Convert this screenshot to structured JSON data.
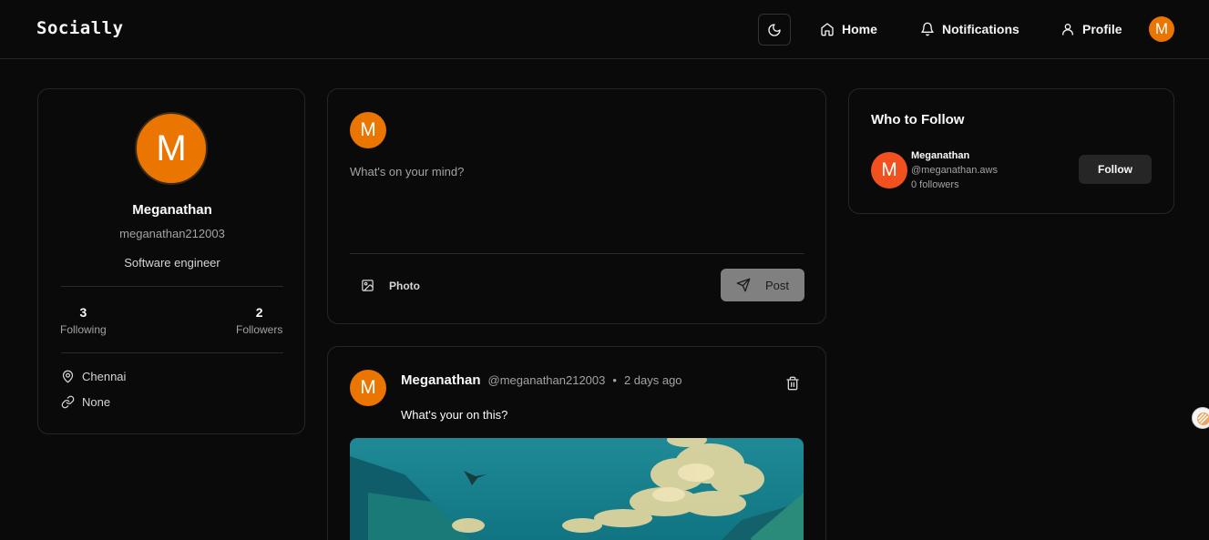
{
  "header": {
    "brand": "Socially",
    "nav": {
      "home": "Home",
      "notifications": "Notifications",
      "profile": "Profile"
    },
    "avatar_initial": "M"
  },
  "profile": {
    "avatar_initial": "M",
    "name": "Meganathan",
    "username": "meganathan212003",
    "bio": "Software engineer",
    "following_count": "3",
    "following_label": "Following",
    "followers_count": "2",
    "followers_label": "Followers",
    "location": "Chennai",
    "website": "None"
  },
  "composer": {
    "avatar_initial": "M",
    "placeholder": "What's on your mind?",
    "photo_label": "Photo",
    "post_label": "Post"
  },
  "post": {
    "avatar_initial": "M",
    "author": "Meganathan",
    "handle": "@meganathan212003",
    "separator": "•",
    "time": "2 days ago",
    "text": "What's your on this?"
  },
  "who_to_follow": {
    "title": "Who to Follow",
    "suggestion": {
      "avatar_initial": "M",
      "name": "Meganathan",
      "handle": "@meganathan.aws",
      "followers": "0 followers",
      "button": "Follow"
    }
  },
  "colors": {
    "background": "#0a0a0a",
    "border": "#262626",
    "avatar_orange": "#ea7500",
    "suggest_avatar": "#f2501f",
    "post_button": "#808080"
  }
}
